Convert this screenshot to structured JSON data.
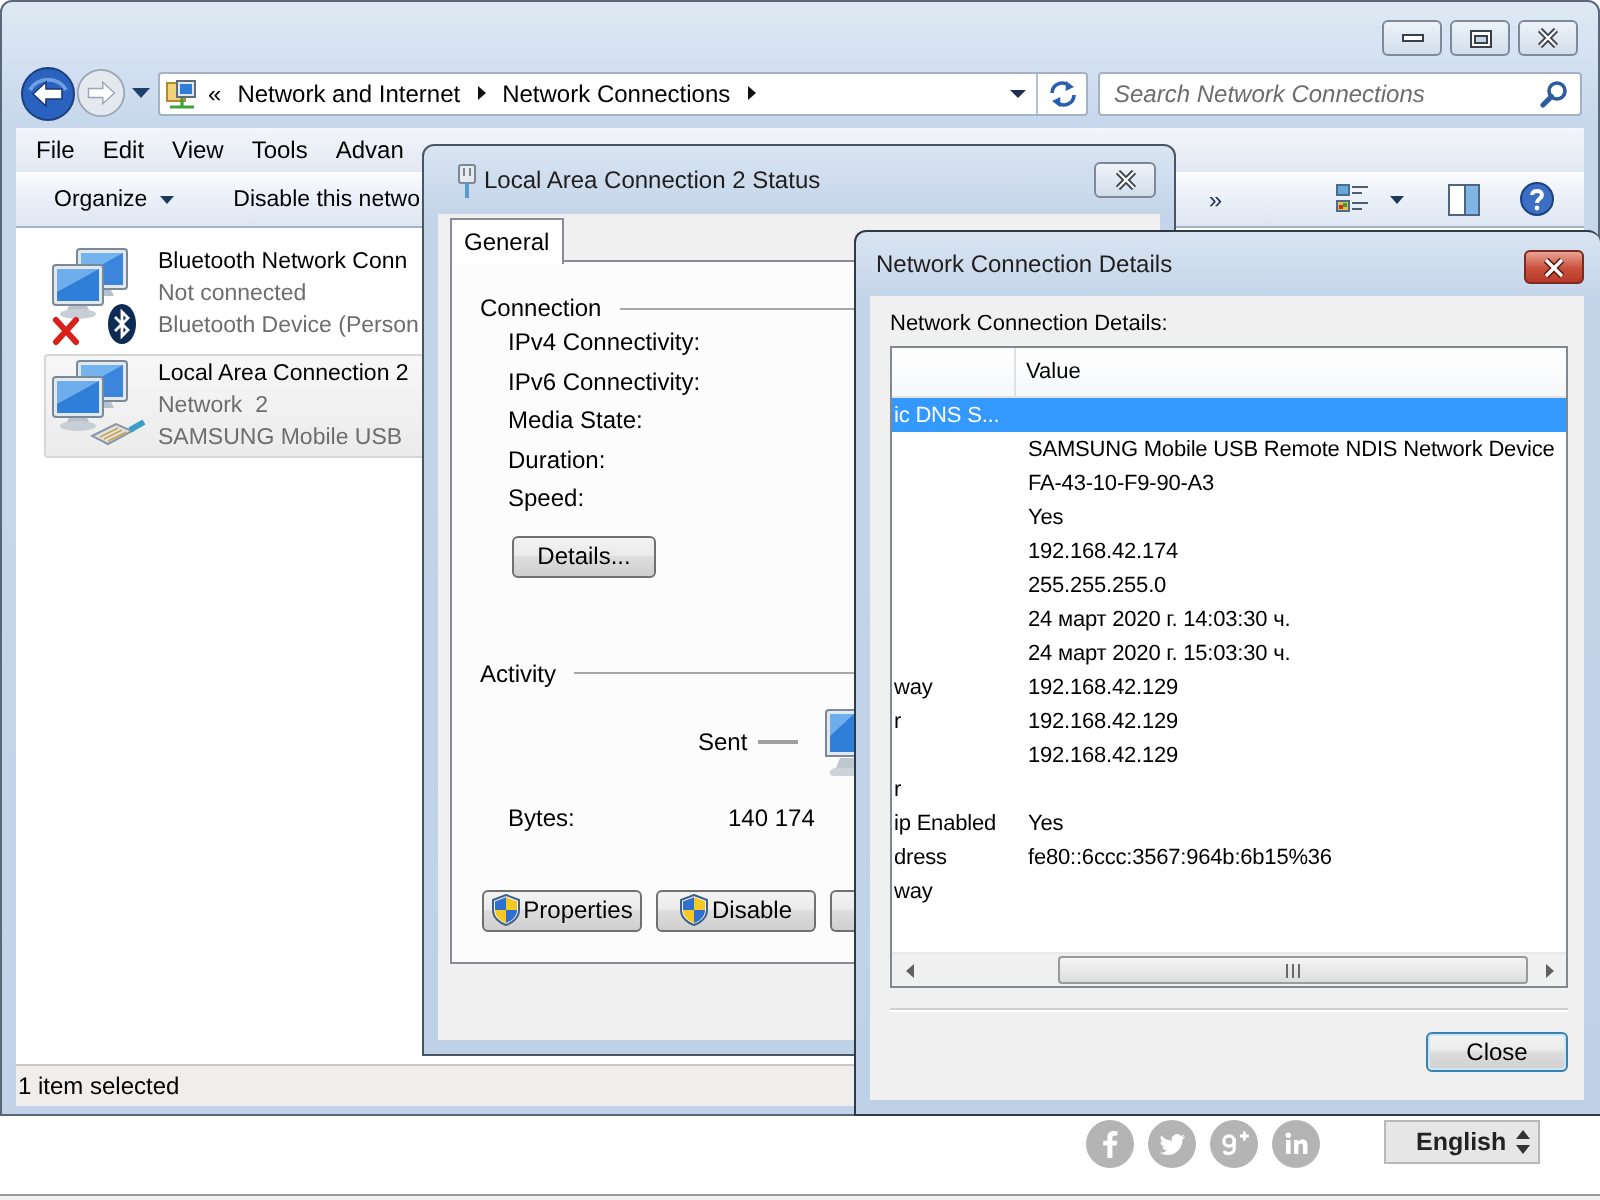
{
  "explorer": {
    "nav_buttons": [
      {
        "kind": "back",
        "disabled": false
      },
      {
        "kind": "forward",
        "disabled": true
      }
    ],
    "address": {
      "overflow": "«",
      "crumbs": [
        "Network and Internet",
        "Network Connections"
      ]
    },
    "search": {
      "placeholder": "Search Network Connections"
    },
    "menu": [
      "File",
      "Edit",
      "View",
      "Tools",
      "Advan"
    ],
    "toolbar": {
      "commands": [
        {
          "label": "Organize",
          "kind": "menu"
        },
        {
          "label": "Disable this netwo",
          "kind": "action"
        }
      ],
      "overflow": "»"
    },
    "connections": [
      {
        "name": "Bluetooth Network Conn",
        "status": "Not connected",
        "device": "Bluetooth Device (Person",
        "kind": "bluetooth",
        "connected": false,
        "selected": false
      },
      {
        "name": "Local Area Connection 2",
        "status": "Network  2",
        "device": "SAMSUNG Mobile USB",
        "kind": "ethernet",
        "connected": true,
        "selected": true
      }
    ],
    "status_bar": "1 item selected"
  },
  "status_dialog": {
    "title": "Local Area Connection 2 Status",
    "tabs": [
      {
        "label": "General",
        "selected": true
      }
    ],
    "connection": {
      "heading": "Connection",
      "fields": [
        "IPv4 Connectivity:",
        "IPv6 Connectivity:",
        "Media State:",
        "Duration:",
        "Speed:"
      ]
    },
    "details_button": "Details...",
    "activity": {
      "heading": "Activity",
      "sent_label": "Sent",
      "bytes_label": "Bytes:",
      "bytes_sent": "140 174"
    },
    "buttons": [
      {
        "label": "Properties",
        "kind": "shield"
      },
      {
        "label": "Disable",
        "kind": "shield"
      },
      {
        "kind": "cut"
      }
    ]
  },
  "details_dialog": {
    "title": "Network Connection Details",
    "caption": "Network Connection Details:",
    "value_column": "Value",
    "rows": [
      {
        "property": "ic DNS S...",
        "selected": true
      },
      {
        "value": "SAMSUNG Mobile USB Remote NDIS Network Device",
        "selected": false
      },
      {
        "value": "FA-43-10-F9-90-A3",
        "selected": false
      },
      {
        "value": "Yes",
        "selected": false
      },
      {
        "value": "192.168.42.174",
        "selected": false
      },
      {
        "value": "255.255.255.0",
        "selected": false
      },
      {
        "value": "24 март 2020 г. 14:03:30 ч.",
        "selected": false
      },
      {
        "value": "24 март 2020 г. 15:03:30 ч.",
        "selected": false
      },
      {
        "property": "way",
        "value": "192.168.42.129",
        "selected": false
      },
      {
        "property": "r",
        "value": "192.168.42.129",
        "selected": false
      },
      {
        "value": "192.168.42.129",
        "selected": false
      },
      {
        "property": "r",
        "selected": false
      },
      {
        "property": "ip Enabled",
        "value": "Yes",
        "selected": false
      },
      {
        "property": "dress",
        "value": "fe80::6ccc:3567:964b:6b15%36",
        "selected": false
      },
      {
        "property": "way",
        "selected": false
      }
    ],
    "close_button": "Close"
  },
  "page": {
    "social_links": [
      {
        "kind": "facebook"
      },
      {
        "kind": "twitter"
      },
      {
        "kind": "google-plus"
      },
      {
        "kind": "linkedin"
      }
    ],
    "language": "English"
  }
}
